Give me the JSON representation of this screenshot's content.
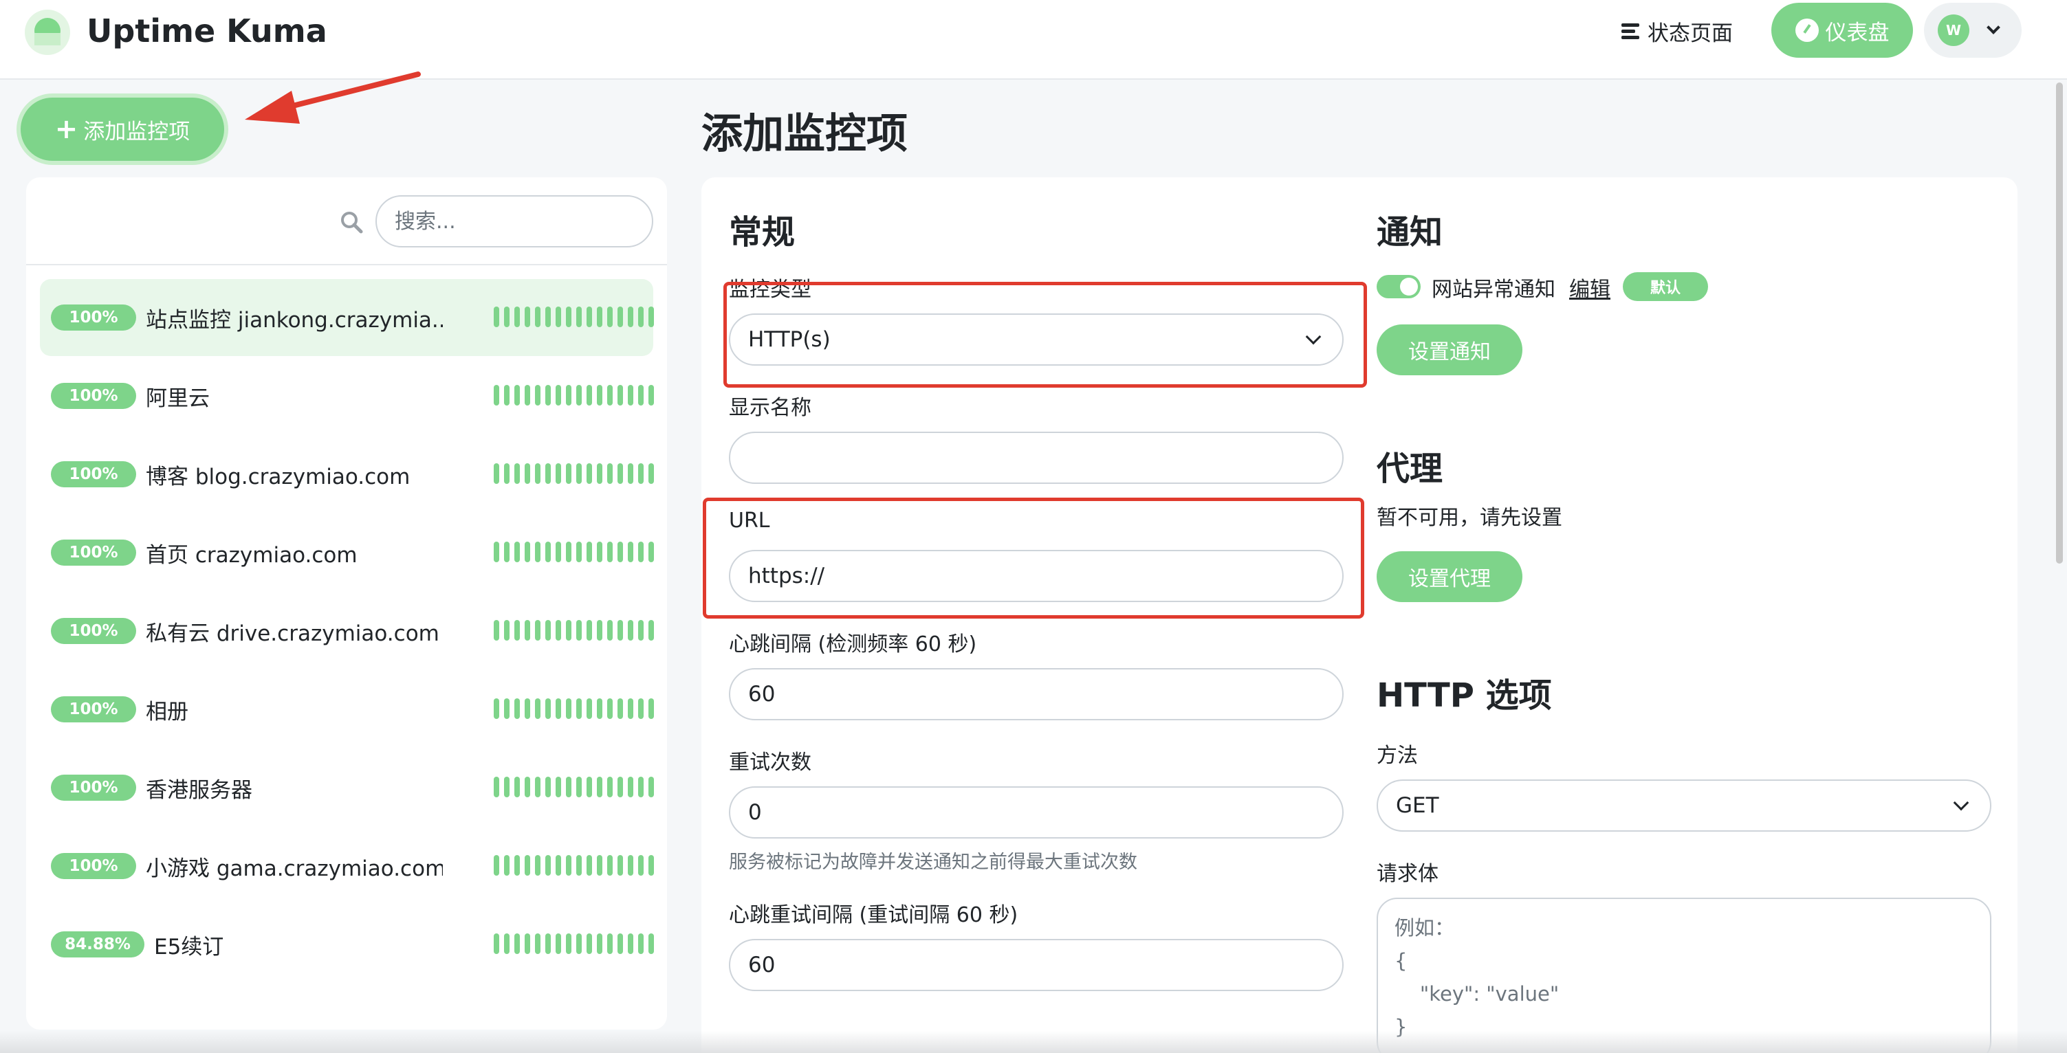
{
  "app": {
    "title": "Uptime Kuma"
  },
  "header": {
    "status_page_label": "状态页面",
    "dashboard_label": "仪表盘",
    "user_initial": "W"
  },
  "sidebar": {
    "add_button_label": "添加监控项",
    "search_placeholder": "搜索...",
    "monitors": [
      {
        "uptime": "100%",
        "name": "站点监控 jiankong.crazymia..."
      },
      {
        "uptime": "100%",
        "name": "阿里云"
      },
      {
        "uptime": "100%",
        "name": "博客 blog.crazymiao.com"
      },
      {
        "uptime": "100%",
        "name": "首页 crazymiao.com"
      },
      {
        "uptime": "100%",
        "name": "私有云 drive.crazymiao.com"
      },
      {
        "uptime": "100%",
        "name": "相册"
      },
      {
        "uptime": "100%",
        "name": "香港服务器"
      },
      {
        "uptime": "100%",
        "name": "小游戏 gama.crazymiao.com"
      },
      {
        "uptime": "84.88%",
        "name": "E5续订"
      }
    ]
  },
  "page": {
    "title": "添加监控项"
  },
  "form": {
    "general_heading": "常规",
    "monitor_type_label": "监控类型",
    "monitor_type_value": "HTTP(s)",
    "friendly_name_label": "显示名称",
    "friendly_name_value": "",
    "url_label": "URL",
    "url_value": "https://",
    "interval_label": "心跳间隔 (检测频率 60 秒)",
    "interval_value": "60",
    "retries_label": "重试次数",
    "retries_value": "0",
    "retries_help": "服务被标记为故障并发送通知之前得最大重试次数",
    "retry_interval_label": "心跳重试间隔 (重试间隔 60 秒)",
    "retry_interval_value": "60"
  },
  "notifications": {
    "heading": "通知",
    "item_label": "网站异常通知",
    "edit_label": "编辑",
    "default_badge": "默认",
    "setup_button": "设置通知"
  },
  "proxy": {
    "heading": "代理",
    "unavailable_text": "暂不可用，请先设置",
    "setup_button": "设置代理"
  },
  "http_options": {
    "heading": "HTTP 选项",
    "method_label": "方法",
    "method_value": "GET",
    "body_label": "请求体",
    "body_placeholder_lines": [
      "例如：",
      "{",
      "    \"key\": \"value\"",
      "}"
    ]
  },
  "colors": {
    "accent_green": "#7ed48a",
    "annotation_red": "#e03b2e"
  }
}
